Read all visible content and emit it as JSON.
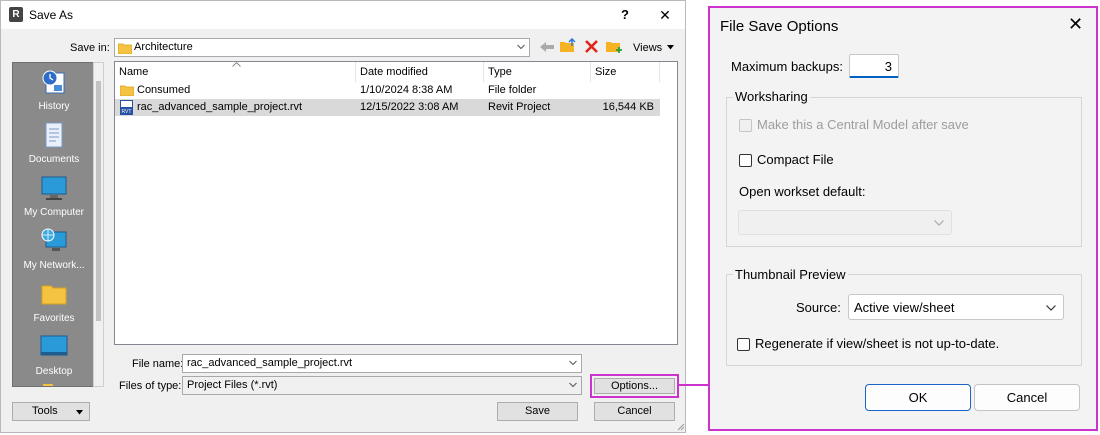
{
  "save_as": {
    "title": "Save As",
    "help_btn": "?",
    "close_btn": "✕",
    "save_in_label": "Save in:",
    "save_in_value": "Architecture",
    "views_label": "Views",
    "places": [
      {
        "label": "History",
        "icon": "history-icon"
      },
      {
        "label": "Documents",
        "icon": "documents-icon"
      },
      {
        "label": "My Computer",
        "icon": "my-computer-icon"
      },
      {
        "label": "My Network...",
        "icon": "my-network-icon"
      },
      {
        "label": "Favorites",
        "icon": "favorites-icon"
      },
      {
        "label": "Desktop",
        "icon": "desktop-icon"
      }
    ],
    "columns": {
      "name": "Name",
      "date": "Date modified",
      "type": "Type",
      "size": "Size"
    },
    "files": [
      {
        "name": "Consumed",
        "date": "1/10/2024 8:38 AM",
        "type": "File folder",
        "size": ""
      },
      {
        "name": "rac_advanced_sample_project.rvt",
        "date": "12/15/2022 3:08 AM",
        "type": "Revit Project",
        "size": "16,544 KB"
      }
    ],
    "file_name_label": "File name:",
    "file_name_value": "rac_advanced_sample_project.rvt",
    "files_of_type_label": "Files of type:",
    "files_of_type_value": "Project Files (*.rvt)",
    "options_btn": "Options...",
    "save_btn": "Save",
    "cancel_btn": "Cancel",
    "tools_btn": "Tools"
  },
  "file_save_options": {
    "title": "File Save Options",
    "close_btn": "✕",
    "max_backups_label": "Maximum backups:",
    "max_backups_value": "3",
    "worksharing_label": "Worksharing",
    "central_model_label": "Make this a Central Model after save",
    "compact_file_label": "Compact File",
    "open_workset_label": "Open workset default:",
    "open_workset_value": "",
    "thumbnail_label": "Thumbnail Preview",
    "source_label": "Source:",
    "source_value": "Active view/sheet",
    "regenerate_label": "Regenerate if view/sheet is not up-to-date.",
    "ok_btn": "OK",
    "cancel_btn": "Cancel"
  },
  "colors": {
    "highlight": "#cc33cc",
    "selected_row": "#d9d9d9",
    "folder": "#f5c342"
  }
}
